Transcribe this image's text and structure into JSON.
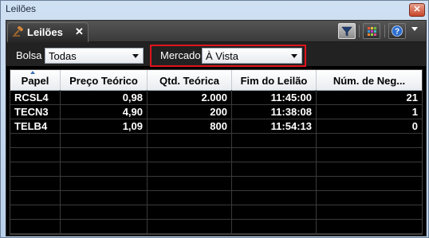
{
  "window": {
    "title": "Leilões"
  },
  "tab": {
    "label": "Leilões",
    "close": "✕"
  },
  "toolbar": {
    "help_glyph": "?"
  },
  "filters": {
    "bolsa_label": "Bolsa",
    "bolsa_value": "Todas",
    "mercado_label": "Mercado",
    "mercado_value": "À Vista"
  },
  "table": {
    "columns": [
      "Papel",
      "Preço Teórico",
      "Qtd. Teórica",
      "Fim do Leilão",
      "Núm. de Neg..."
    ],
    "rows": [
      [
        "RCSL4",
        "0,98",
        "2.000",
        "11:45:00",
        "21"
      ],
      [
        "TECN3",
        "4,90",
        "200",
        "11:38:08",
        "1"
      ],
      [
        "TELB4",
        "1,09",
        "800",
        "11:54:13",
        "0"
      ]
    ],
    "sort_column": "Papel"
  },
  "colors": {
    "highlight": "#e0141c",
    "grid_bg": "#000000",
    "text": "#ffffff"
  }
}
